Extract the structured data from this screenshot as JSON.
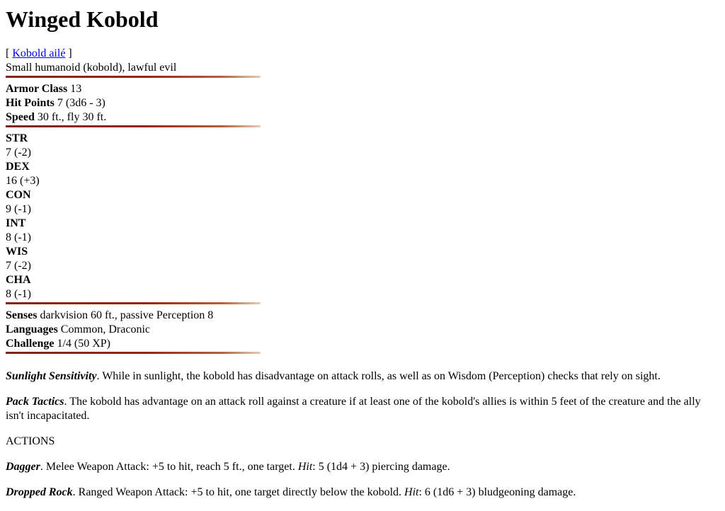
{
  "title": "Winged Kobold",
  "alt_name": {
    "bracket_open": "[ ",
    "link_text": "Kobold ailé",
    "bracket_close": " ]"
  },
  "type_line": "Small humanoid (kobold), lawful evil",
  "defense": {
    "armor_class_label": "Armor Class",
    "armor_class_value": " 13",
    "hit_points_label": "Hit Points",
    "hit_points_value": " 7 (3d6 - 3)",
    "speed_label": "Speed",
    "speed_value": " 30 ft., fly 30 ft."
  },
  "abilities": [
    {
      "name": "STR",
      "value": "7 (-2)"
    },
    {
      "name": "DEX",
      "value": "16 (+3)"
    },
    {
      "name": "CON",
      "value": "9 (-1)"
    },
    {
      "name": "INT",
      "value": "8 (-1)"
    },
    {
      "name": "WIS",
      "value": "7 (-2)"
    },
    {
      "name": "CHA",
      "value": "8 (-1)"
    }
  ],
  "details": {
    "senses_label": "Senses",
    "senses_value": " darkvision 60 ft., passive Perception 8",
    "languages_label": "Languages",
    "languages_value": " Common, Draconic",
    "challenge_label": "Challenge",
    "challenge_value": " 1/4 (50 XP)"
  },
  "traits": [
    {
      "name": "Sunlight Sensitivity",
      "text": ". While in sunlight, the kobold has disadvantage on attack rolls, as well as on Wisdom (Perception) checks that rely on sight."
    },
    {
      "name": "Pack Tactics",
      "text": ". The kobold has advantage on an attack roll against a creature if at least one of the kobold's allies is within 5 feet of the creature and the ally isn't incapacitated."
    }
  ],
  "actions_heading": "ACTIONS",
  "actions": [
    {
      "name": "Dagger",
      "text_before": ". Melee Weapon Attack: +5 to hit, reach 5 ft., one target. ",
      "hit_label": "Hit",
      "text_after": ": 5 (1d4 + 3) piercing damage."
    },
    {
      "name": "Dropped Rock",
      "text_before": ". Ranged Weapon Attack: +5 to hit, one target directly below the kobold. ",
      "hit_label": "Hit",
      "text_after": ": 6 (1d6 + 3) bludgeoning damage."
    }
  ]
}
